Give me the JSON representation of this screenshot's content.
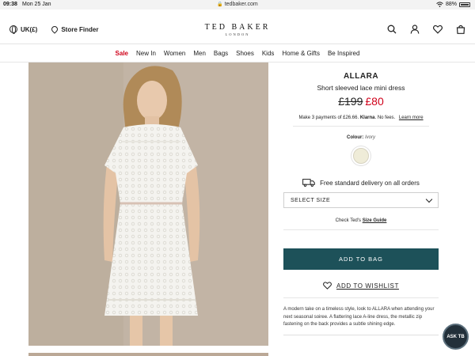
{
  "status_bar": {
    "time": "09:38",
    "date": "Mon 25 Jan",
    "url": "tedbaker.com",
    "battery": "88%"
  },
  "header": {
    "region": "UK(£)",
    "store_finder": "Store Finder",
    "logo_main": "TED BAKER",
    "logo_sub": "LONDON",
    "icons": [
      "search-icon",
      "account-icon",
      "heart-icon",
      "bag-icon"
    ]
  },
  "nav": {
    "items": [
      "Sale",
      "New In",
      "Women",
      "Men",
      "Bags",
      "Shoes",
      "Kids",
      "Home & Gifts",
      "Be Inspired"
    ]
  },
  "product": {
    "name": "ALLARA",
    "description": "Short sleeved lace mini dress",
    "old_price": "£199",
    "new_price": "£80",
    "klarna_prefix": "Make 3 payments of £26.66.",
    "klarna_brand": "Klarna",
    "klarna_suffix": ". No fees.",
    "klarna_link": "Learn more",
    "colour_label": "Colour:",
    "colour_value": "Ivory",
    "delivery": "Free standard delivery on all orders",
    "select_size": "SELECT SIZE",
    "size_guide_prefix": "Check Ted's",
    "size_guide_link": "Size Guide",
    "add_to_bag": "ADD TO BAG",
    "add_to_wishlist": "ADD TO WISHLIST",
    "long_description": "A modern take on a timeless style, look to ALLARA when attending your next seasonal soiree. A flattering lace A-line dress, the metallic zip fastening on the back provides a subtle shining edge."
  },
  "ask_button": "ASK TB",
  "colors": {
    "accent": "#1d5159",
    "sale": "#d0021b",
    "swatch": "#efecd8"
  }
}
